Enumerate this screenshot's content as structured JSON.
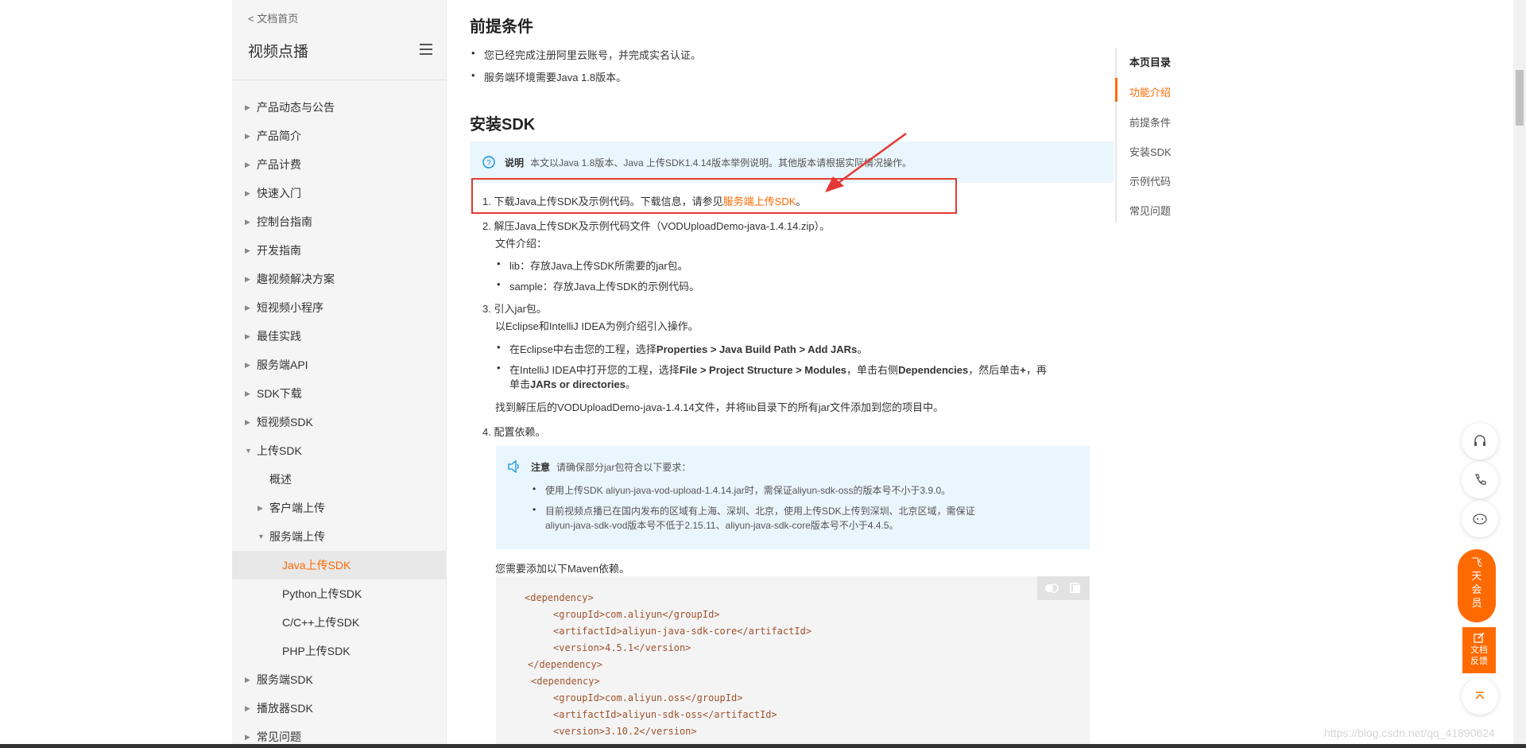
{
  "sidebar": {
    "back_link": "< 文档首页",
    "product_title": "视频点播",
    "items": [
      {
        "label": "产品动态与公告",
        "level": 0,
        "state": "collapsed"
      },
      {
        "label": "产品简介",
        "level": 0,
        "state": "collapsed"
      },
      {
        "label": "产品计费",
        "level": 0,
        "state": "collapsed"
      },
      {
        "label": "快速入门",
        "level": 0,
        "state": "collapsed"
      },
      {
        "label": "控制台指南",
        "level": 0,
        "state": "collapsed"
      },
      {
        "label": "开发指南",
        "level": 0,
        "state": "collapsed"
      },
      {
        "label": "趣视频解决方案",
        "level": 0,
        "state": "collapsed"
      },
      {
        "label": "短视频小程序",
        "level": 0,
        "state": "collapsed"
      },
      {
        "label": "最佳实践",
        "level": 0,
        "state": "collapsed"
      },
      {
        "label": "服务端API",
        "level": 0,
        "state": "collapsed"
      },
      {
        "label": "SDK下载",
        "level": 0,
        "state": "collapsed"
      },
      {
        "label": "短视频SDK",
        "level": 0,
        "state": "collapsed"
      },
      {
        "label": "上传SDK",
        "level": 0,
        "state": "expanded"
      },
      {
        "label": "概述",
        "level": 1,
        "state": "leaf"
      },
      {
        "label": "客户端上传",
        "level": 1,
        "state": "collapsed"
      },
      {
        "label": "服务端上传",
        "level": 1,
        "state": "expanded"
      },
      {
        "label": "Java上传SDK",
        "level": 2,
        "state": "active"
      },
      {
        "label": "Python上传SDK",
        "level": 2,
        "state": "leaf"
      },
      {
        "label": "C/C++上传SDK",
        "level": 2,
        "state": "leaf"
      },
      {
        "label": "PHP上传SDK",
        "level": 2,
        "state": "leaf"
      },
      {
        "label": "服务端SDK",
        "level": 0,
        "state": "collapsed"
      },
      {
        "label": "播放器SDK",
        "level": 0,
        "state": "collapsed"
      },
      {
        "label": "常见问题",
        "level": 0,
        "state": "collapsed"
      }
    ]
  },
  "content": {
    "prereq_title": "前提条件",
    "prereq_items": [
      "您已经完成注册阿里云账号，并完成实名认证。",
      "服务端环境需要Java 1.8版本。"
    ],
    "install_title": "安装SDK",
    "note_label": "说明",
    "note_text": "本文以Java 1.8版本、Java 上传SDK1.4.14版本举例说明。其他版本请根据实际情况操作。",
    "step1_text": "1. 下载Java上传SDK及示例代码。下载信息，请参见",
    "step1_link": "服务端上传SDK",
    "step1_end": "。",
    "step2_text": "2. 解压Java上传SDK及示例代码文件（VODUploadDemo-java-1.4.14.zip）。",
    "step2_sub": "文件介绍：",
    "step2_items": [
      "lib：存放Java上传SDK所需要的jar包。",
      "sample：存放Java上传SDK的示例代码。"
    ],
    "step3_text": "3. 引入jar包。",
    "step3_sub": "以Eclipse和IntelliJ IDEA为例介绍引入操作。",
    "step3_b1_pre": "在Eclipse中右击您的工程，选择",
    "step3_b1_bold": "Properties > Java Build Path > Add JARs",
    "step3_b1_end": "。",
    "step3_b2_pre": "在IntelliJ IDEA中打开您的工程，选择",
    "step3_b2_bold1": "File > Project Structure > Modules",
    "step3_b2_mid": "，单击右侧",
    "step3_b2_bold2": "Dependencies",
    "step3_b2_mid2": "，然后单击",
    "step3_b2_bold3": "+",
    "step3_b2_mid3": "，再",
    "step3_b2_line2_pre": "单击",
    "step3_b2_bold4": "JARs or directories",
    "step3_b2_end": "。",
    "step3_after": "找到解压后的VODUploadDemo-java-1.4.14文件，并将lib目录下的所有jar文件添加到您的项目中。",
    "step4_text": "4. 配置依赖。",
    "attention_label": "注意",
    "attention_text": "请确保部分jar包符合以下要求：",
    "attention_items": [
      "使用上传SDK aliyun-java-vod-upload-1.4.14.jar时，需保证aliyun-sdk-oss的版本号不小于3.9.0。",
      "目前视频点播已在国内发布的区域有上海、深圳、北京，使用上传SDK上传到深圳、北京区域，需保证",
      "aliyun-java-sdk-vod版本号不低于2.15.11、aliyun-java-sdk-core版本号不小于4.4.5。"
    ],
    "maven_text": "您需要添加以下Maven依赖。",
    "code_lines": [
      "<dependency>",
      "<groupId>com.aliyun</groupId>",
      "<artifactId>aliyun-java-sdk-core</artifactId>",
      "<version>4.5.1</version>",
      "</dependency>",
      "<dependency>",
      "<groupId>com.aliyun.oss</groupId>",
      "<artifactId>aliyun-sdk-oss</artifactId>",
      "<version>3.10.2</version>"
    ]
  },
  "toc": {
    "title": "本页目录",
    "items": [
      "功能介绍",
      "前提条件",
      "安装SDK",
      "示例代码",
      "常见问题"
    ],
    "active": "功能介绍"
  },
  "floating": {
    "vip_label": "飞天会员",
    "feedback_label": "文档反馈",
    "icons": [
      "headset-icon",
      "phone-icon",
      "chat-icon",
      "back-to-top-icon"
    ]
  },
  "watermark": "https://blog.csdn.net/qq_41890624",
  "colors": {
    "accent": "#ff6a00",
    "note_bg": "#eaf6fd",
    "annotation_red": "#e53935"
  }
}
